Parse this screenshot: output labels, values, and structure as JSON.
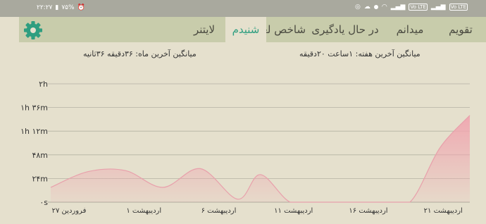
{
  "status_bar": {
    "time": "۲۲:۲۷",
    "battery": "۷۵%",
    "badges": [
      "Vo LTE",
      "Vo LTE"
    ]
  },
  "header": {
    "tabs": [
      {
        "label": "تقویم",
        "active": false
      },
      {
        "label": "میدانم",
        "active": false
      },
      {
        "label": "در حال یادگیری",
        "active": false
      },
      {
        "label": "شاخص لغت",
        "active": false
      },
      {
        "label": "شنیدم",
        "active": true
      },
      {
        "label": "لایتنر",
        "active": false
      }
    ],
    "settings_icon": "gear-icon",
    "accent_color": "#2e9e80"
  },
  "stats": {
    "week_avg": "میانگین آخرین هفته: ۱ساعت ۲۰دقیقه",
    "month_avg": "میانگین آخرین ماه: ۳۶دقیقه ۳۶ثانیه"
  },
  "chart_data": {
    "type": "area",
    "ylabels": [
      "۰s",
      "۲۴m",
      "۴۸m",
      "۱h ۱۲m",
      "۱h ۳۶m",
      "۲h"
    ],
    "yticks_minutes": [
      0,
      24,
      48,
      72,
      96,
      120
    ],
    "ylim": [
      0,
      120
    ],
    "xlabels": [
      "۲۷ فروردین",
      "۱ اردیبهشت",
      "۶ اردیبهشت",
      "۱۱ اردیبهشت",
      "۱۶ اردیبهشت",
      "۲۱ اردیبهشت"
    ],
    "xlabel_days": [
      0,
      5,
      10,
      15,
      20,
      25
    ],
    "series": [
      {
        "x_days": [
          0,
          2.5,
          5,
          7.5,
          10,
          12.5,
          14,
          16,
          18,
          20,
          22,
          24,
          26,
          28
        ],
        "values": [
          15,
          31,
          32,
          15,
          34,
          3,
          28,
          0,
          0,
          0,
          0,
          0,
          55,
          88
        ]
      }
    ],
    "fill_color": "#f0a6b0",
    "line_color": "#e8a0ab",
    "grid": true
  }
}
